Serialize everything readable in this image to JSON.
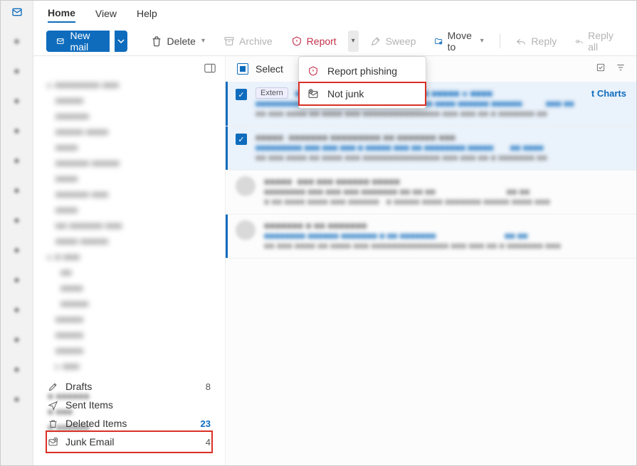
{
  "menu": {
    "home": "Home",
    "view": "View",
    "help": "Help"
  },
  "toolbar": {
    "new_mail": "New mail",
    "delete": "Delete",
    "archive": "Archive",
    "report": "Report",
    "sweep": "Sweep",
    "move_to": "Move to",
    "reply": "Reply",
    "reply_all": "Reply all"
  },
  "report_menu": {
    "phishing": "Report phishing",
    "not_junk": "Not junk"
  },
  "message_header": {
    "select": "Select"
  },
  "messages": [
    {
      "tag": "Extern",
      "visible_title_fragment": "t Charts"
    }
  ],
  "nav": {
    "drafts": {
      "label": "Drafts",
      "count": "8"
    },
    "sent": {
      "label": "Sent Items"
    },
    "deleted": {
      "label": "Deleted Items",
      "count": "23"
    },
    "junk": {
      "label": "Junk Email",
      "count": "4"
    }
  }
}
